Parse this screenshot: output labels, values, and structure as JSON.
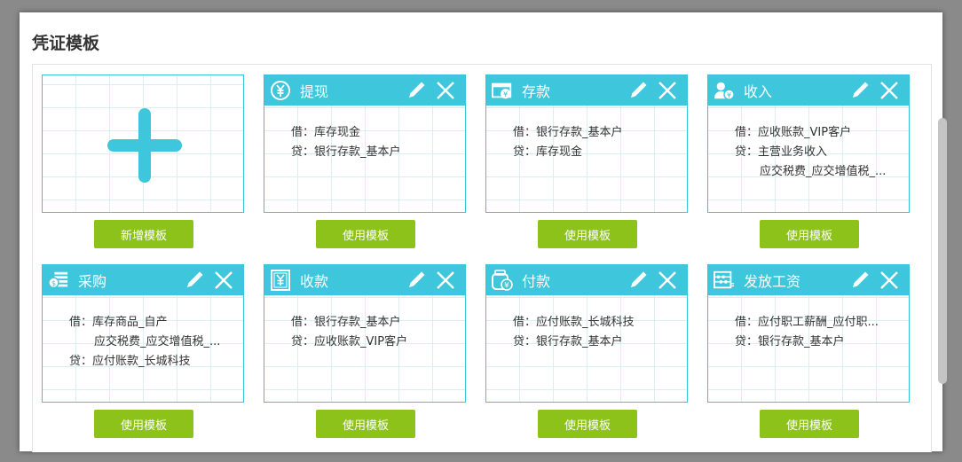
{
  "page": {
    "title": "凭证模板"
  },
  "new_card": {
    "button_label": "新增模板"
  },
  "templates": [
    {
      "name": "提现",
      "icon": "yen-circle-icon",
      "lines": [
        {
          "prefix": "借：",
          "text": "库存现金"
        },
        {
          "prefix": "贷：",
          "text": "银行存款_基本户"
        }
      ],
      "button_label": "使用模板"
    },
    {
      "name": "存款",
      "icon": "deposit-icon",
      "lines": [
        {
          "prefix": "借：",
          "text": "银行存款_基本户"
        },
        {
          "prefix": "贷：",
          "text": "库存现金"
        }
      ],
      "button_label": "使用模板"
    },
    {
      "name": "收入",
      "icon": "income-user-icon",
      "lines": [
        {
          "prefix": "借：",
          "text": "应收账款_VIP客户"
        },
        {
          "prefix": "贷：",
          "text": "主营业务收入"
        },
        {
          "prefix": "",
          "text": "应交税费_应交增值税_..."
        }
      ],
      "button_label": "使用模板"
    },
    {
      "name": "采购",
      "icon": "purchase-icon",
      "lines": [
        {
          "prefix": "借：",
          "text": "库存商品_自产"
        },
        {
          "prefix": "",
          "text": "应交税费_应交增值税_..."
        },
        {
          "prefix": "贷：",
          "text": "应付账款_长城科技"
        }
      ],
      "button_label": "使用模板"
    },
    {
      "name": "收款",
      "icon": "receipt-icon",
      "lines": [
        {
          "prefix": "借：",
          "text": "银行存款_基本户"
        },
        {
          "prefix": "贷：",
          "text": "应收账款_VIP客户"
        }
      ],
      "button_label": "使用模板"
    },
    {
      "name": "付款",
      "icon": "payment-icon",
      "lines": [
        {
          "prefix": "借：",
          "text": "应付账款_长城科技"
        },
        {
          "prefix": "贷：",
          "text": "银行存款_基本户"
        }
      ],
      "button_label": "使用模板"
    },
    {
      "name": "发放工资",
      "icon": "abacus-icon",
      "lines": [
        {
          "prefix": "借：",
          "text": "应付职工薪酬_应付职..."
        },
        {
          "prefix": "贷：",
          "text": "银行存款_基本户"
        }
      ],
      "button_label": "使用模板"
    }
  ],
  "colors": {
    "accent": "#3ec6dc",
    "button": "#8cc21a",
    "grid": "#d6f0f4"
  }
}
